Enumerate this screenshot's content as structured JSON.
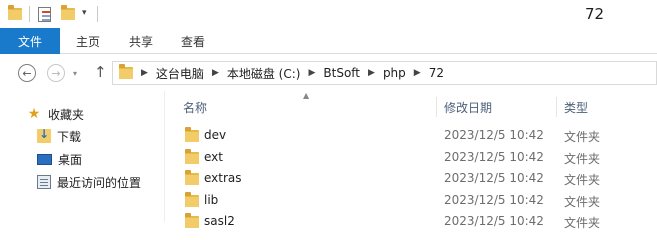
{
  "window": {
    "title": "72"
  },
  "ribbon": {
    "tabs": [
      {
        "label": "文件"
      },
      {
        "label": "主页"
      },
      {
        "label": "共享"
      },
      {
        "label": "查看"
      }
    ]
  },
  "address": {
    "crumbs": [
      "这台电脑",
      "本地磁盘 (C:)",
      "BtSoft",
      "php",
      "72"
    ]
  },
  "navpane": {
    "items": [
      {
        "label": "收藏夹",
        "icon": "star-icon"
      },
      {
        "label": "下载",
        "icon": "download-folder-icon"
      },
      {
        "label": "桌面",
        "icon": "desktop-icon"
      },
      {
        "label": "最近访问的位置",
        "icon": "recent-places-icon"
      }
    ]
  },
  "filelist": {
    "columns": {
      "name": "名称",
      "date": "修改日期",
      "type": "类型"
    },
    "rows": [
      {
        "name": "dev",
        "date": "2023/12/5 10:42",
        "type": "文件夹"
      },
      {
        "name": "ext",
        "date": "2023/12/5 10:42",
        "type": "文件夹"
      },
      {
        "name": "extras",
        "date": "2023/12/5 10:42",
        "type": "文件夹"
      },
      {
        "name": "lib",
        "date": "2023/12/5 10:42",
        "type": "文件夹"
      },
      {
        "name": "sasl2",
        "date": "2023/12/5 10:42",
        "type": "文件夹"
      }
    ]
  },
  "colors": {
    "accent": "#1979ca",
    "folder": "#f3cc6a",
    "header_text": "#4c607a"
  }
}
